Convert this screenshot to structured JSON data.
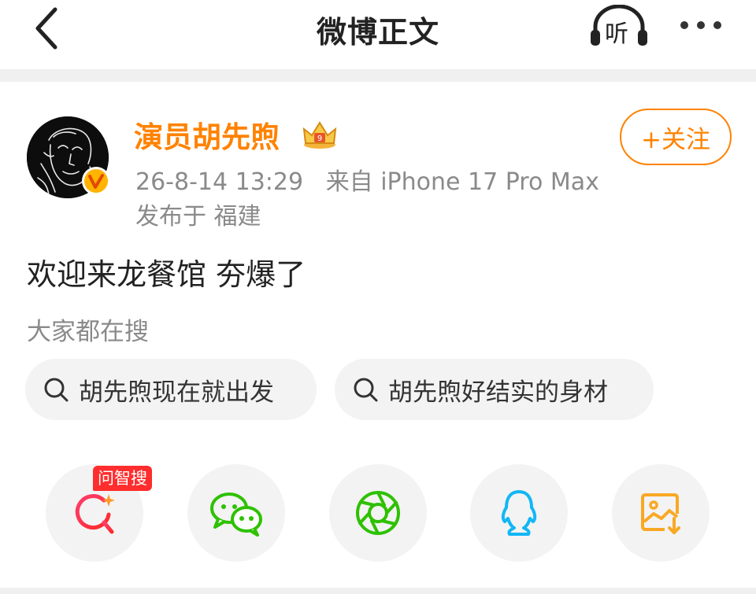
{
  "header": {
    "title": "微博正文",
    "listen_label": "听"
  },
  "post": {
    "author": "演员胡先煦",
    "follow_label": "+关注",
    "timestamp": "26-8-14 13:29",
    "source": "来自 iPhone 17 Pro Max",
    "location": "发布于 福建",
    "text": "欢迎来龙餐馆 夯爆了"
  },
  "search": {
    "label": "大家都在搜",
    "chips": [
      "胡先煦现在就出发",
      "胡先煦好结实的身材"
    ]
  },
  "share_bar": {
    "ai_search_tag": "问智搜",
    "items": [
      "ai-search-icon",
      "wechat-icon",
      "moments-icon",
      "qq-icon",
      "save-image-icon"
    ]
  },
  "colors": {
    "brand_orange": "#ff8200",
    "ai_red": "#ff2d2d",
    "wechat_green": "#2dc100",
    "qq_blue": "#12b7f5",
    "save_orange": "#f9a825"
  }
}
